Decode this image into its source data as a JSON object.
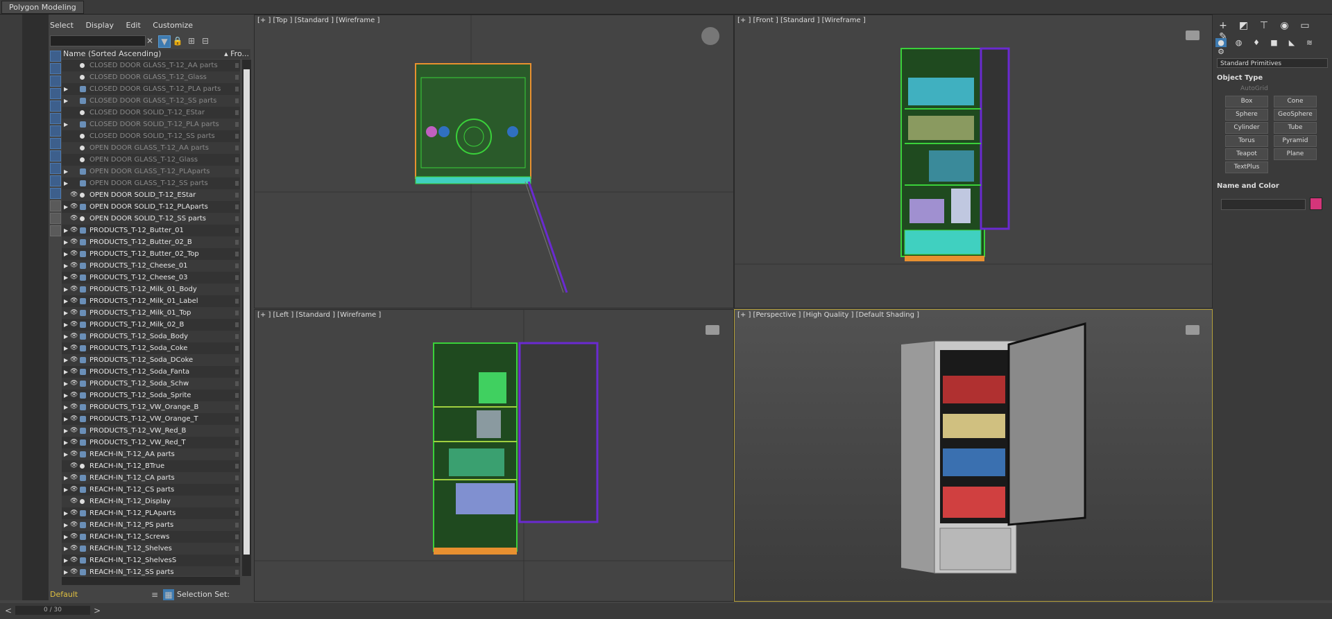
{
  "ribbon": {
    "tab_label": "Polygon Modeling"
  },
  "explorer": {
    "menu": [
      "Select",
      "Display",
      "Edit",
      "Customize"
    ],
    "search_placeholder": "",
    "column_name": "Name (Sorted Ascending)",
    "column_extra": "▴ Fro...",
    "rows": [
      {
        "label": "CLOSED DOOR GLASS_T-12_AA parts",
        "hidden": true,
        "expand": false
      },
      {
        "label": "CLOSED DOOR GLASS_T-12_Glass",
        "hidden": true,
        "expand": false
      },
      {
        "label": "CLOSED DOOR GLASS_T-12_PLA parts",
        "hidden": true,
        "expand": true
      },
      {
        "label": "CLOSED DOOR GLASS_T-12_SS parts",
        "hidden": true,
        "expand": true
      },
      {
        "label": "CLOSED DOOR SOLID_T-12_EStar",
        "hidden": true,
        "expand": false
      },
      {
        "label": "CLOSED DOOR SOLID_T-12_PLA parts",
        "hidden": true,
        "expand": true
      },
      {
        "label": "CLOSED DOOR SOLID_T-12_SS parts",
        "hidden": true,
        "expand": false
      },
      {
        "label": "OPEN DOOR GLASS_T-12_AA parts",
        "hidden": true,
        "expand": false
      },
      {
        "label": "OPEN DOOR GLASS_T-12_Glass",
        "hidden": true,
        "expand": false
      },
      {
        "label": "OPEN DOOR GLASS_T-12_PLAparts",
        "hidden": true,
        "expand": true
      },
      {
        "label": "OPEN DOOR GLASS_T-12_SS parts",
        "hidden": true,
        "expand": true
      },
      {
        "label": "OPEN DOOR SOLID_T-12_EStar",
        "hidden": false,
        "expand": false
      },
      {
        "label": "OPEN DOOR SOLID_T-12_PLAparts",
        "hidden": false,
        "expand": true
      },
      {
        "label": "OPEN DOOR SOLID_T-12_SS parts",
        "hidden": false,
        "expand": false
      },
      {
        "label": "PRODUCTS_T-12_Butter_01",
        "hidden": false,
        "expand": true
      },
      {
        "label": "PRODUCTS_T-12_Butter_02_B",
        "hidden": false,
        "expand": true
      },
      {
        "label": "PRODUCTS_T-12_Butter_02_Top",
        "hidden": false,
        "expand": true
      },
      {
        "label": "PRODUCTS_T-12_Cheese_01",
        "hidden": false,
        "expand": true
      },
      {
        "label": "PRODUCTS_T-12_Cheese_03",
        "hidden": false,
        "expand": true
      },
      {
        "label": "PRODUCTS_T-12_Milk_01_Body",
        "hidden": false,
        "expand": true
      },
      {
        "label": "PRODUCTS_T-12_Milk_01_Label",
        "hidden": false,
        "expand": true
      },
      {
        "label": "PRODUCTS_T-12_Milk_01_Top",
        "hidden": false,
        "expand": true
      },
      {
        "label": "PRODUCTS_T-12_Milk_02_B",
        "hidden": false,
        "expand": true
      },
      {
        "label": "PRODUCTS_T-12_Soda_Body",
        "hidden": false,
        "expand": true
      },
      {
        "label": "PRODUCTS_T-12_Soda_Coke",
        "hidden": false,
        "expand": true
      },
      {
        "label": "PRODUCTS_T-12_Soda_DCoke",
        "hidden": false,
        "expand": true
      },
      {
        "label": "PRODUCTS_T-12_Soda_Fanta",
        "hidden": false,
        "expand": true
      },
      {
        "label": "PRODUCTS_T-12_Soda_Schw",
        "hidden": false,
        "expand": true
      },
      {
        "label": "PRODUCTS_T-12_Soda_Sprite",
        "hidden": false,
        "expand": true
      },
      {
        "label": "PRODUCTS_T-12_VW_Orange_B",
        "hidden": false,
        "expand": true
      },
      {
        "label": "PRODUCTS_T-12_VW_Orange_T",
        "hidden": false,
        "expand": true
      },
      {
        "label": "PRODUCTS_T-12_VW_Red_B",
        "hidden": false,
        "expand": true
      },
      {
        "label": "PRODUCTS_T-12_VW_Red_T",
        "hidden": false,
        "expand": true
      },
      {
        "label": "REACH-IN_T-12_AA parts",
        "hidden": false,
        "expand": true
      },
      {
        "label": "REACH-IN_T-12_BTrue",
        "hidden": false,
        "expand": false
      },
      {
        "label": "REACH-IN_T-12_CA parts",
        "hidden": false,
        "expand": true
      },
      {
        "label": "REACH-IN_T-12_CS parts",
        "hidden": false,
        "expand": true
      },
      {
        "label": "REACH-IN_T-12_Display",
        "hidden": false,
        "expand": false
      },
      {
        "label": "REACH-IN_T-12_PLAparts",
        "hidden": false,
        "expand": true
      },
      {
        "label": "REACH-IN_T-12_PS parts",
        "hidden": false,
        "expand": true
      },
      {
        "label": "REACH-IN_T-12_Screws",
        "hidden": false,
        "expand": true
      },
      {
        "label": "REACH-IN_T-12_Shelves",
        "hidden": false,
        "expand": true
      },
      {
        "label": "REACH-IN_T-12_ShelvesS",
        "hidden": false,
        "expand": true
      },
      {
        "label": "REACH-IN_T-12_SS parts",
        "hidden": false,
        "expand": true
      }
    ],
    "layer": "Default",
    "selection_set": "Selection Set:"
  },
  "viewports": {
    "top": "[+ ] [Top ]  [Standard ]  [Wireframe ]",
    "front": "[+ ] [Front ]  [Standard ]  [Wireframe ]",
    "left": "[+ ] [Left ]  [Standard ]  [Wireframe ]",
    "perspective": "[+ ] [Perspective ]  [High Quality ]  [Default Shading ]"
  },
  "command_panel": {
    "dropdown": "Standard Primitives",
    "object_type": "Object Type",
    "autogrid": "AutoGrid",
    "buttons": [
      "Box",
      "Cone",
      "Sphere",
      "GeoSphere",
      "Cylinder",
      "Tube",
      "Torus",
      "Pyramid",
      "Teapot",
      "Plane",
      "TextPlus"
    ],
    "name_and_color": "Name and Color",
    "color": "#d4357a"
  },
  "status": {
    "frame_counter": "0 / 30"
  },
  "colors": {
    "accent": "#3d7ab0",
    "wire_green": "#3ad13a",
    "wire_purple": "#6a2ad1",
    "selection_border": "#b5a03a"
  }
}
